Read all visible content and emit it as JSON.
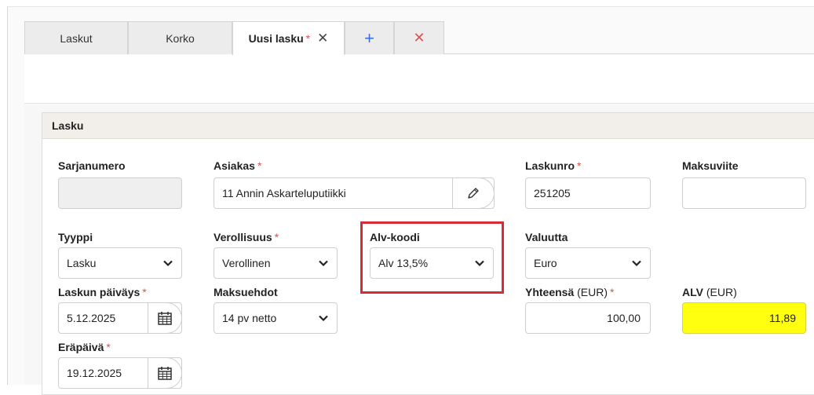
{
  "tabs": [
    {
      "label": "Laskut"
    },
    {
      "label": "Korko"
    },
    {
      "label": "Uusi lasku",
      "required_mark": "*",
      "close_glyph": "✕"
    },
    {
      "glyph": "+"
    },
    {
      "glyph": "✕"
    }
  ],
  "panel": {
    "title": "Lasku"
  },
  "fields": {
    "sarjanumero": {
      "label": "Sarjanumero",
      "value": ""
    },
    "asiakas": {
      "label": "Asiakas",
      "required_mark": "*",
      "value": "11 Annin Askarteluputiikki",
      "edit_icon": "pencil-icon"
    },
    "laskunro": {
      "label": "Laskunro",
      "required_mark": "*",
      "value": "251205"
    },
    "maksuviite": {
      "label": "Maksuviite",
      "value": ""
    },
    "tyyppi": {
      "label": "Tyyppi",
      "value": "Lasku"
    },
    "verollisuus": {
      "label": "Verollisuus",
      "required_mark": "*",
      "value": "Verollinen"
    },
    "alv_koodi": {
      "label": "Alv-koodi",
      "value": "Alv 13,5%"
    },
    "valuutta": {
      "label": "Valuutta",
      "value": "Euro"
    },
    "laskun_paivays": {
      "label": "Laskun päiväys",
      "required_mark": "*",
      "value": "5.12.2025",
      "icon": "calendar-icon"
    },
    "maksuehdot": {
      "label": "Maksuehdot",
      "value": "14 pv netto"
    },
    "yhteensa": {
      "label": "Yhteensä",
      "unit": "(EUR)",
      "required_mark": "*",
      "value": "100,00"
    },
    "alv_eur": {
      "label": "ALV",
      "unit": "(EUR)",
      "value": "11,89"
    },
    "erapaiva": {
      "label": "Eräpäivä",
      "required_mark": "*",
      "value": "19.12.2025",
      "icon": "calendar-icon"
    }
  },
  "colors": {
    "required": "#d9534f",
    "highlight_field": "#ffff0f",
    "annotation_box": "#d62c36",
    "tab_add": "#3b6fd6"
  }
}
